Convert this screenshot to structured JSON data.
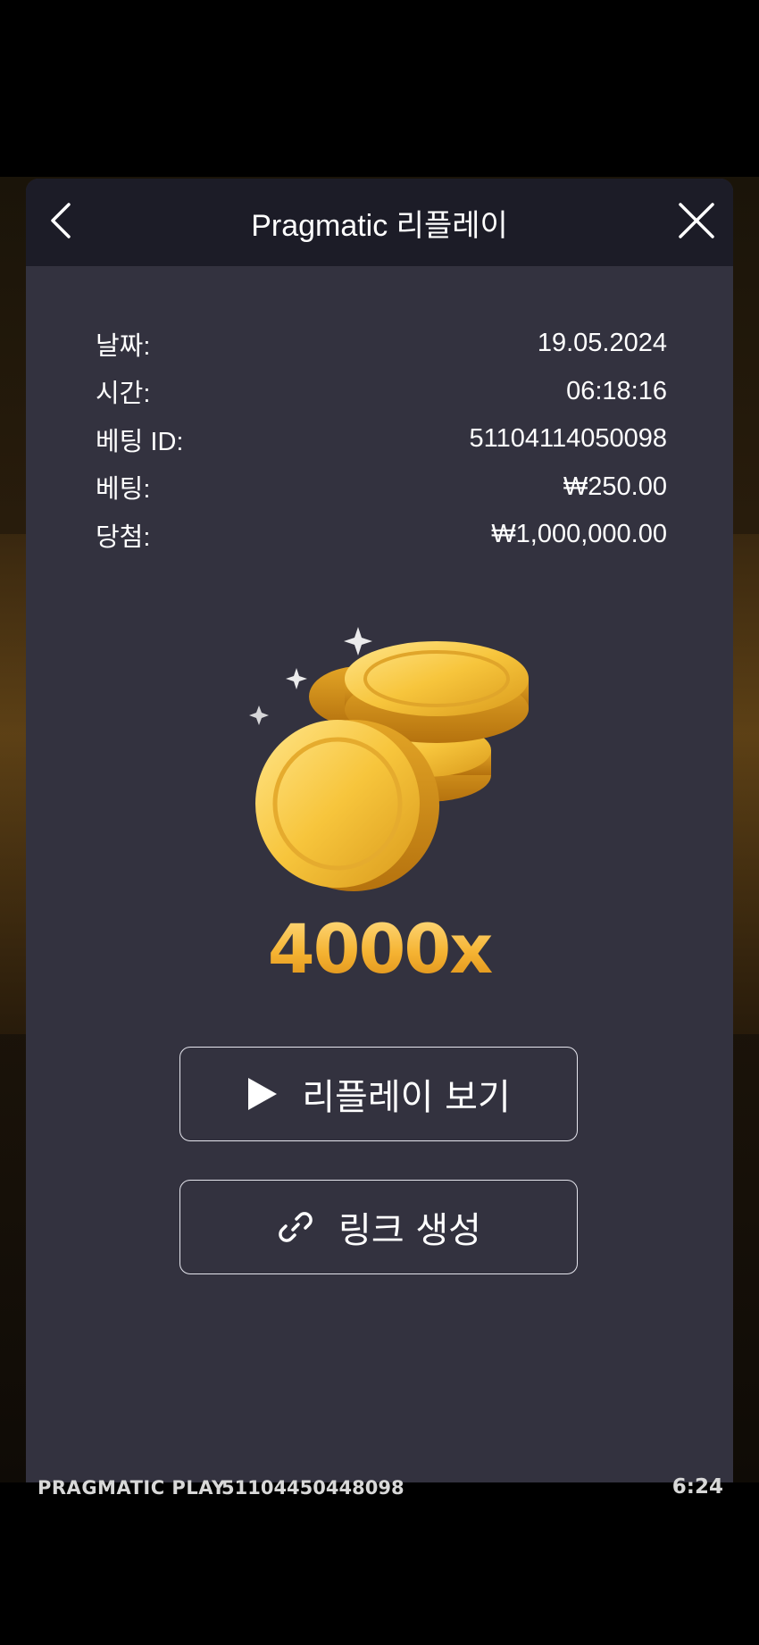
{
  "dialog": {
    "title": "Pragmatic 리플레이"
  },
  "info": [
    {
      "label": "날짜:",
      "value": "19.05.2024"
    },
    {
      "label": "시간:",
      "value": "06:18:16"
    },
    {
      "label": "베팅 ID:",
      "value": "51104114050098"
    },
    {
      "label": "베팅:",
      "value": "₩250.00"
    },
    {
      "label": "당첨:",
      "value": "₩1,000,000.00"
    }
  ],
  "win": {
    "multiplier": "4000x",
    "icon": "coins-icon"
  },
  "buttons": {
    "replay_label": "리플레이 보기",
    "replay_icon": "play-icon",
    "link_label": "링크 생성",
    "link_icon": "link-icon"
  },
  "footer": {
    "brand": "PRAGMATIC PLAY",
    "round_id": "51104450448098",
    "clock": "6:24"
  },
  "colors": {
    "dialog_bg": "#33323f",
    "header_bg": "#1c1c27",
    "accent_gold": "#f5b332"
  }
}
